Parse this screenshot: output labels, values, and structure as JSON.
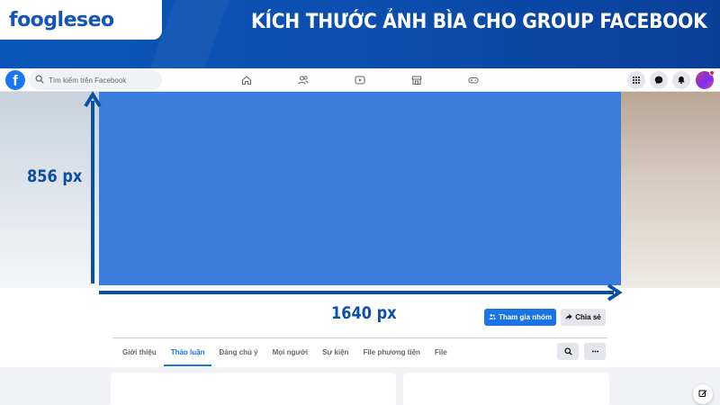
{
  "banner": {
    "logo_part1": "foogle",
    "logo_part2": "seo",
    "title": "KÍCH THƯỚC ẢNH BÌA CHO GROUP FACEBOOK"
  },
  "fb_header": {
    "logo_letter": "f",
    "search_placeholder": "Tìm kiếm trên Facebook",
    "nav_icons": [
      "home-icon",
      "friends-icon",
      "video-icon",
      "marketplace-icon",
      "gaming-icon"
    ],
    "right_icons": [
      "menu-grid-icon",
      "messenger-icon",
      "notification-bell-icon"
    ]
  },
  "cover": {
    "height_label": "856 px",
    "width_label": "1640 px",
    "photo_color": "#3b7ddd",
    "arrow_color": "#0a4fa8"
  },
  "actions": {
    "join_label": "Tham gia nhóm",
    "share_label": "Chia sẻ"
  },
  "tabs": [
    {
      "label": "Giới thiệu",
      "active": false
    },
    {
      "label": "Thảo luận",
      "active": true
    },
    {
      "label": "Đáng chú ý",
      "active": false
    },
    {
      "label": "Mọi người",
      "active": false
    },
    {
      "label": "Sự kiện",
      "active": false
    },
    {
      "label": "File phương tiện",
      "active": false
    },
    {
      "label": "File",
      "active": false
    }
  ],
  "colors": {
    "banner_blue": "#0b4fb0",
    "facebook_blue": "#1877f2",
    "accent": "#1b74e4"
  }
}
